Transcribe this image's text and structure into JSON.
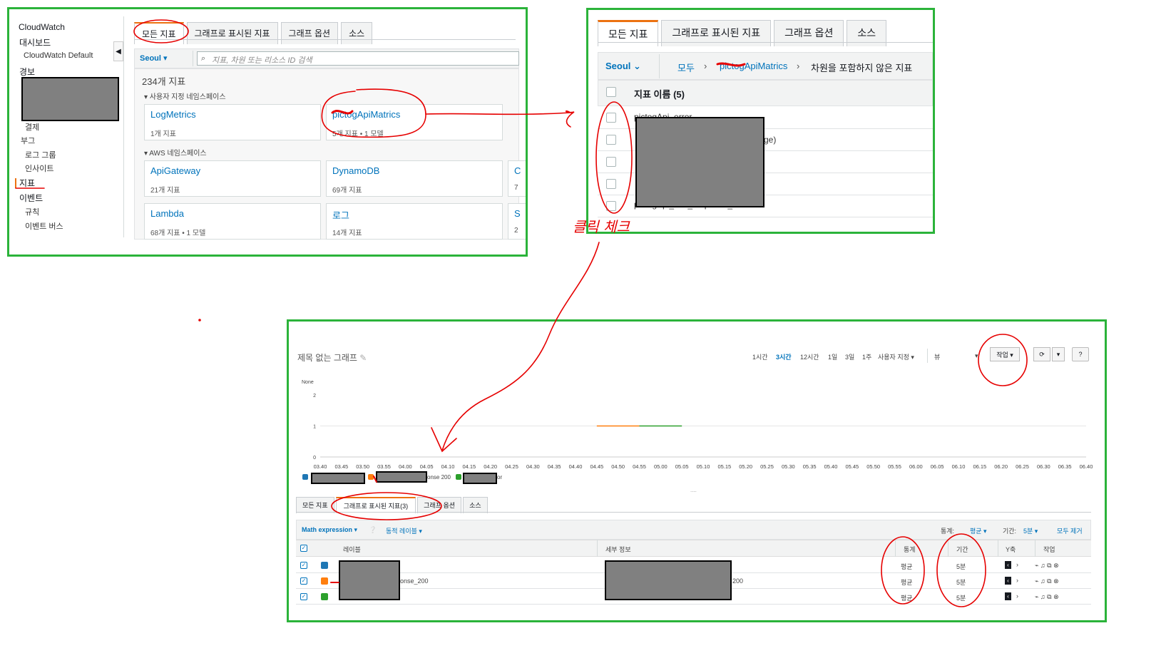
{
  "panel1": {
    "nav": {
      "items": [
        {
          "label": "CloudWatch"
        },
        {
          "label": "대시보드"
        },
        {
          "label": "CloudWatch Default"
        },
        {
          "label": "경보"
        },
        {
          "label": "결제"
        },
        {
          "label": "부그"
        },
        {
          "label": "로그 그룹"
        },
        {
          "label": "인사이트"
        },
        {
          "label": "지표"
        },
        {
          "label": "이벤트"
        },
        {
          "label": "규칙"
        },
        {
          "label": "이벤트 버스"
        }
      ]
    },
    "tabs": [
      "모든 지표",
      "그래프로 표시된 지표",
      "그래프 옵션",
      "소스"
    ],
    "region": "Seoul ▾",
    "search_placeholder": "지표, 차원 또는 리소스 ID 검색",
    "metric_count": "234개 지표",
    "custom_ns_heading": "▾ 사용자 지정 네임스페이스",
    "aws_ns_heading": "▾ AWS 네임스페이스",
    "custom_cards": [
      {
        "title": "LogMetrics",
        "sub": "1개 지표"
      },
      {
        "title": "pictogApiMatrics",
        "sub": "5개 지표 • 1 모델"
      }
    ],
    "aws_cards": [
      {
        "title": "ApiGateway",
        "sub": "21개 지표"
      },
      {
        "title": "DynamoDB",
        "sub": "69개 지표"
      },
      {
        "title": "Lambda",
        "sub": "68개 지표 • 1 모델"
      },
      {
        "title": "로그",
        "sub": "14개 지표"
      }
    ],
    "cut_cards": [
      {
        "title": "C",
        "sub": "7"
      },
      {
        "title": "S",
        "sub": "2"
      }
    ]
  },
  "panel2": {
    "tabs": [
      "모든 지표",
      "그래프로 표시된 지표",
      "그래프 옵션",
      "소스"
    ],
    "region": "Seoul",
    "crumb_all": "모두",
    "crumb_ns": "pictogApiMatrics",
    "crumb_dim": "차원을 포함하지 않은 지표",
    "col_header": "지표 이름 (5)",
    "rows": [
      "pictogApi_error",
      "ge)",
      "",
      "",
      "pictogApi_info_response_200"
    ],
    "annotation": "클릭 체크"
  },
  "panel3": {
    "title": "제목 없는 그래프",
    "time_buttons": [
      "1시간",
      "3시간",
      "12시간",
      "1일",
      "3일",
      "1주",
      "사용자 지정 ▾"
    ],
    "view_select": "뷰",
    "actions_label": "작업 ▾",
    "y_unit": "None",
    "y_ticks": [
      "2",
      "1",
      "0"
    ],
    "x_ticks": [
      "03.40",
      "03.45",
      "03.50",
      "03.55",
      "04.00",
      "04.05",
      "04.10",
      "04.15",
      "04.20",
      "04.25",
      "04.30",
      "04.35",
      "04.40",
      "04.45",
      "04.50",
      "04.55",
      "05.00",
      "05.05",
      "05.10",
      "05.15",
      "05.20",
      "05.25",
      "05.30",
      "05.35",
      "05.40",
      "05.45",
      "05.50",
      "05.55",
      "06.00",
      "06.05",
      "06.10",
      "06.15",
      "06.20",
      "06.25",
      "06.30",
      "06.35",
      "06.40"
    ],
    "legend_suffixes": [
      "",
      "onse 200",
      "or"
    ],
    "tabs": [
      "모든 지표",
      "그래프로 표시된 지표(3)",
      "그래프 옵션",
      "소스"
    ],
    "math_expression": "Math expression ▾",
    "dynamic_labels": "동적 레이블 ▾",
    "stat_label": "통계:",
    "stat_value": "평균 ▾",
    "period_label": "기간:",
    "period_value": "5분 ▾",
    "remove_all": "모두 제거",
    "columns": [
      "레이블",
      "세부 정보",
      "통계",
      "기간",
      "Y축",
      "작업"
    ],
    "rows": [
      {
        "label_tail": "",
        "detail_tail": "",
        "stat": "평균",
        "period": "5분",
        "color": "#1f77b4"
      },
      {
        "label_tail": "onse_200",
        "detail_tail": "200",
        "stat": "평균",
        "period": "5분",
        "color": "#ff7f0e"
      },
      {
        "label_tail": "",
        "detail_tail": "",
        "stat": "평균",
        "period": "5분",
        "color": "#2ca02c"
      }
    ]
  },
  "chart_data": {
    "type": "line",
    "ylabel": "None",
    "ylim": [
      0,
      2
    ],
    "x": [
      "03.40",
      "03.45",
      "03.50",
      "03.55",
      "04.00",
      "04.05",
      "04.10",
      "04.15",
      "04.20",
      "04.25",
      "04.30",
      "04.35",
      "04.40",
      "04.45",
      "04.50",
      "04.55",
      "05.00",
      "05.05",
      "05.10",
      "05.15",
      "05.20",
      "05.25",
      "05.30",
      "05.35",
      "05.40",
      "05.45",
      "05.50",
      "05.55",
      "06.00",
      "06.05",
      "06.10",
      "06.15",
      "06.20",
      "06.25",
      "06.30",
      "06.35",
      "06.40"
    ],
    "series": [
      {
        "color": "#ff7f0e",
        "points": [
          [
            "04.45",
            1
          ],
          [
            "04.55",
            1
          ]
        ]
      },
      {
        "color": "#2ca02c",
        "points": [
          [
            "04.55",
            1
          ],
          [
            "05.05",
            1
          ]
        ]
      }
    ]
  },
  "colors": {
    "frame": "#2bb33a",
    "accent": "#ec7211",
    "link": "#0073bb",
    "annotation": "#e60000",
    "redaction": "#808080"
  }
}
